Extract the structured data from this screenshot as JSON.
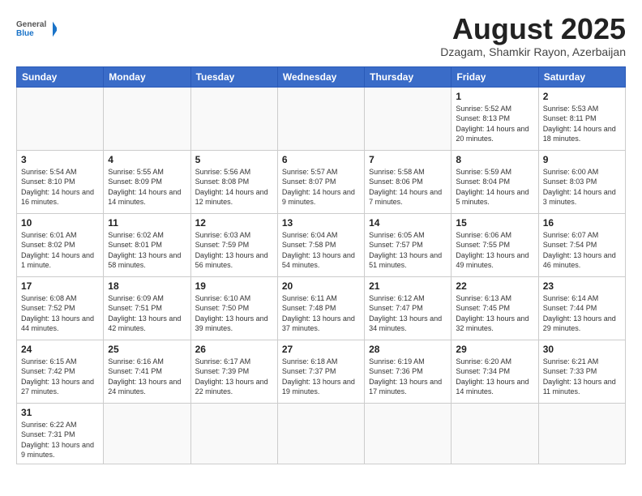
{
  "logo": {
    "text_general": "General",
    "text_blue": "Blue"
  },
  "title": {
    "month_year": "August 2025",
    "location": "Dzagam, Shamkir Rayon, Azerbaijan"
  },
  "weekdays": [
    "Sunday",
    "Monday",
    "Tuesday",
    "Wednesday",
    "Thursday",
    "Friday",
    "Saturday"
  ],
  "weeks": [
    [
      {
        "day": "",
        "info": ""
      },
      {
        "day": "",
        "info": ""
      },
      {
        "day": "",
        "info": ""
      },
      {
        "day": "",
        "info": ""
      },
      {
        "day": "",
        "info": ""
      },
      {
        "day": "1",
        "info": "Sunrise: 5:52 AM\nSunset: 8:13 PM\nDaylight: 14 hours and 20 minutes."
      },
      {
        "day": "2",
        "info": "Sunrise: 5:53 AM\nSunset: 8:11 PM\nDaylight: 14 hours and 18 minutes."
      }
    ],
    [
      {
        "day": "3",
        "info": "Sunrise: 5:54 AM\nSunset: 8:10 PM\nDaylight: 14 hours and 16 minutes."
      },
      {
        "day": "4",
        "info": "Sunrise: 5:55 AM\nSunset: 8:09 PM\nDaylight: 14 hours and 14 minutes."
      },
      {
        "day": "5",
        "info": "Sunrise: 5:56 AM\nSunset: 8:08 PM\nDaylight: 14 hours and 12 minutes."
      },
      {
        "day": "6",
        "info": "Sunrise: 5:57 AM\nSunset: 8:07 PM\nDaylight: 14 hours and 9 minutes."
      },
      {
        "day": "7",
        "info": "Sunrise: 5:58 AM\nSunset: 8:06 PM\nDaylight: 14 hours and 7 minutes."
      },
      {
        "day": "8",
        "info": "Sunrise: 5:59 AM\nSunset: 8:04 PM\nDaylight: 14 hours and 5 minutes."
      },
      {
        "day": "9",
        "info": "Sunrise: 6:00 AM\nSunset: 8:03 PM\nDaylight: 14 hours and 3 minutes."
      }
    ],
    [
      {
        "day": "10",
        "info": "Sunrise: 6:01 AM\nSunset: 8:02 PM\nDaylight: 14 hours and 1 minute."
      },
      {
        "day": "11",
        "info": "Sunrise: 6:02 AM\nSunset: 8:01 PM\nDaylight: 13 hours and 58 minutes."
      },
      {
        "day": "12",
        "info": "Sunrise: 6:03 AM\nSunset: 7:59 PM\nDaylight: 13 hours and 56 minutes."
      },
      {
        "day": "13",
        "info": "Sunrise: 6:04 AM\nSunset: 7:58 PM\nDaylight: 13 hours and 54 minutes."
      },
      {
        "day": "14",
        "info": "Sunrise: 6:05 AM\nSunset: 7:57 PM\nDaylight: 13 hours and 51 minutes."
      },
      {
        "day": "15",
        "info": "Sunrise: 6:06 AM\nSunset: 7:55 PM\nDaylight: 13 hours and 49 minutes."
      },
      {
        "day": "16",
        "info": "Sunrise: 6:07 AM\nSunset: 7:54 PM\nDaylight: 13 hours and 46 minutes."
      }
    ],
    [
      {
        "day": "17",
        "info": "Sunrise: 6:08 AM\nSunset: 7:52 PM\nDaylight: 13 hours and 44 minutes."
      },
      {
        "day": "18",
        "info": "Sunrise: 6:09 AM\nSunset: 7:51 PM\nDaylight: 13 hours and 42 minutes."
      },
      {
        "day": "19",
        "info": "Sunrise: 6:10 AM\nSunset: 7:50 PM\nDaylight: 13 hours and 39 minutes."
      },
      {
        "day": "20",
        "info": "Sunrise: 6:11 AM\nSunset: 7:48 PM\nDaylight: 13 hours and 37 minutes."
      },
      {
        "day": "21",
        "info": "Sunrise: 6:12 AM\nSunset: 7:47 PM\nDaylight: 13 hours and 34 minutes."
      },
      {
        "day": "22",
        "info": "Sunrise: 6:13 AM\nSunset: 7:45 PM\nDaylight: 13 hours and 32 minutes."
      },
      {
        "day": "23",
        "info": "Sunrise: 6:14 AM\nSunset: 7:44 PM\nDaylight: 13 hours and 29 minutes."
      }
    ],
    [
      {
        "day": "24",
        "info": "Sunrise: 6:15 AM\nSunset: 7:42 PM\nDaylight: 13 hours and 27 minutes."
      },
      {
        "day": "25",
        "info": "Sunrise: 6:16 AM\nSunset: 7:41 PM\nDaylight: 13 hours and 24 minutes."
      },
      {
        "day": "26",
        "info": "Sunrise: 6:17 AM\nSunset: 7:39 PM\nDaylight: 13 hours and 22 minutes."
      },
      {
        "day": "27",
        "info": "Sunrise: 6:18 AM\nSunset: 7:37 PM\nDaylight: 13 hours and 19 minutes."
      },
      {
        "day": "28",
        "info": "Sunrise: 6:19 AM\nSunset: 7:36 PM\nDaylight: 13 hours and 17 minutes."
      },
      {
        "day": "29",
        "info": "Sunrise: 6:20 AM\nSunset: 7:34 PM\nDaylight: 13 hours and 14 minutes."
      },
      {
        "day": "30",
        "info": "Sunrise: 6:21 AM\nSunset: 7:33 PM\nDaylight: 13 hours and 11 minutes."
      }
    ],
    [
      {
        "day": "31",
        "info": "Sunrise: 6:22 AM\nSunset: 7:31 PM\nDaylight: 13 hours and 9 minutes."
      },
      {
        "day": "",
        "info": ""
      },
      {
        "day": "",
        "info": ""
      },
      {
        "day": "",
        "info": ""
      },
      {
        "day": "",
        "info": ""
      },
      {
        "day": "",
        "info": ""
      },
      {
        "day": "",
        "info": ""
      }
    ]
  ]
}
